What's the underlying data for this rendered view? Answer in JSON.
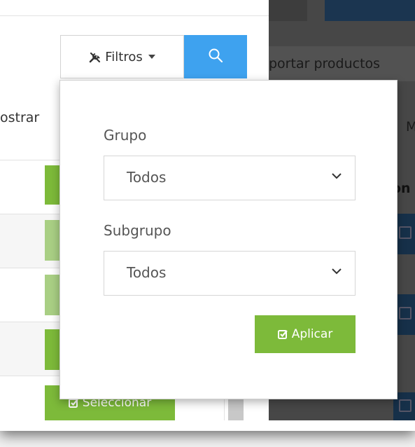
{
  "background": {
    "import_label": "portar productos",
    "header_fragment": "M",
    "row_fragment": "on"
  },
  "toolbar": {
    "filters_label": "Filtros",
    "mostrar_label": "ostrar"
  },
  "filters_popover": {
    "group_label": "Grupo",
    "group_value": "Todos",
    "subgroup_label": "Subgrupo",
    "subgroup_value": "Todos",
    "apply_label": "Aplicar"
  },
  "table": {
    "select_label": "Seleccionar"
  },
  "colors": {
    "accent_blue": "#3ea2ef",
    "accent_green": "#7dba3a",
    "dim_overlay": "#474747"
  }
}
